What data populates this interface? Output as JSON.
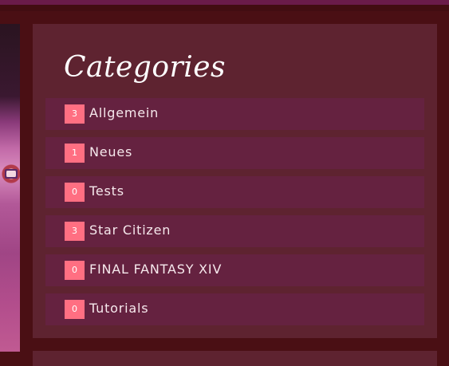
{
  "widget": {
    "title": "Categories"
  },
  "categories": [
    {
      "count": "3",
      "label": "Allgemein"
    },
    {
      "count": "1",
      "label": "Neues"
    },
    {
      "count": "0",
      "label": "Tests"
    },
    {
      "count": "3",
      "label": "Star Citizen"
    },
    {
      "count": "0",
      "label": "FINAL FANTASY XIV"
    },
    {
      "count": "0",
      "label": "Tutorials"
    }
  ],
  "colors": {
    "page_background": "#4a0f14",
    "widget_background": "#5e2330",
    "item_background": "#652240",
    "count_badge": "#ff6f82",
    "text": "#f6e8ec"
  }
}
